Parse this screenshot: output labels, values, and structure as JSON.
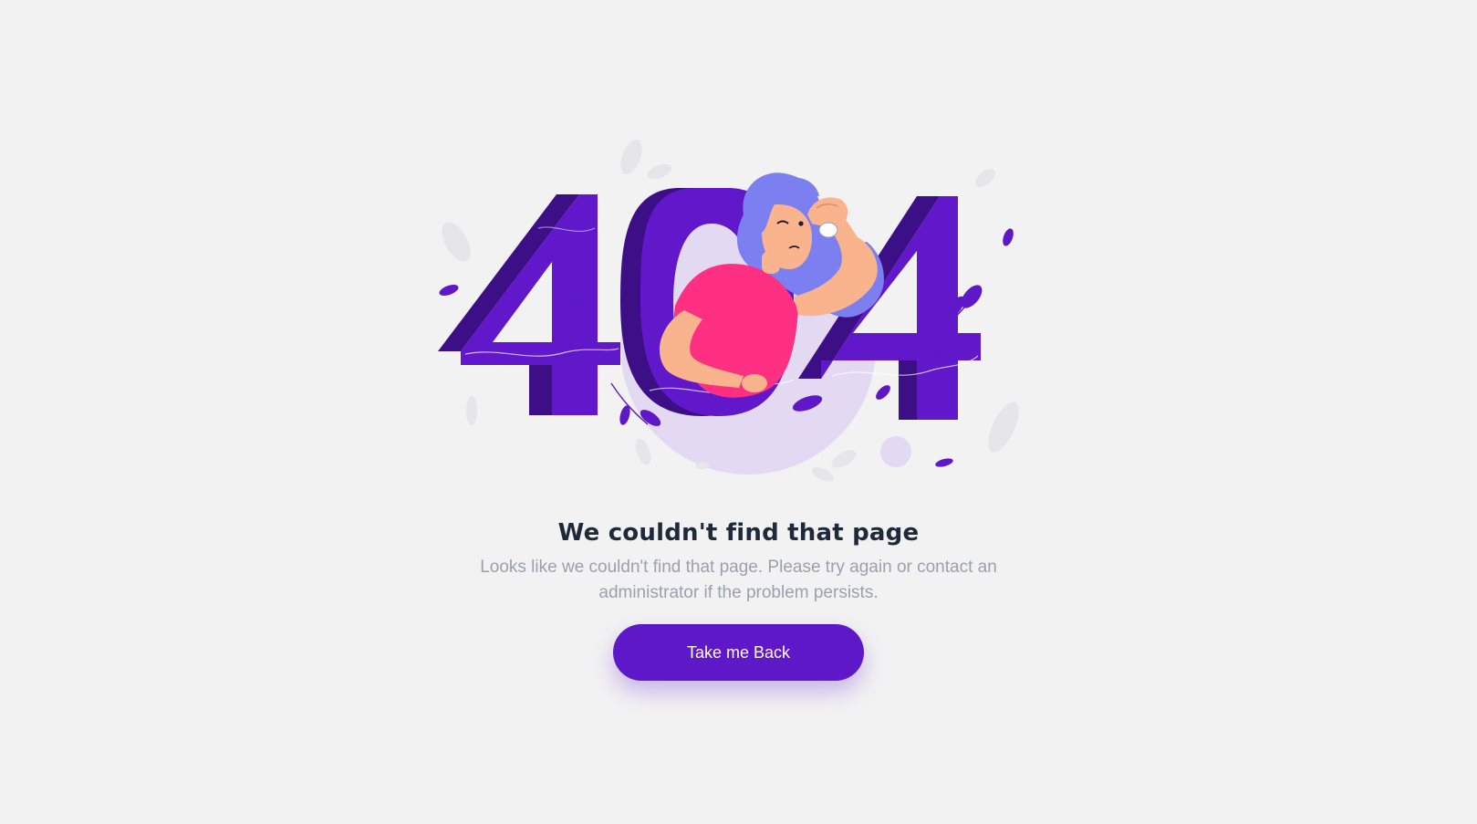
{
  "error_page": {
    "title": "We couldn't find that page",
    "message": "Looks like we couldn't find that page. Please try again or contact an administrator if the problem persists.",
    "back_button_label": "Take me Back"
  },
  "illustration": {
    "digits_text": "404",
    "digit_color": "#5f18c8",
    "digit_shadow_color": "#3c0f86",
    "accent_pink": "#ff2f82",
    "hair_color": "#7b7ff0"
  },
  "colors": {
    "background": "#f2f2f3",
    "title": "#1e2a3a",
    "message": "#9aa1ad",
    "button": "#5f18c8"
  }
}
